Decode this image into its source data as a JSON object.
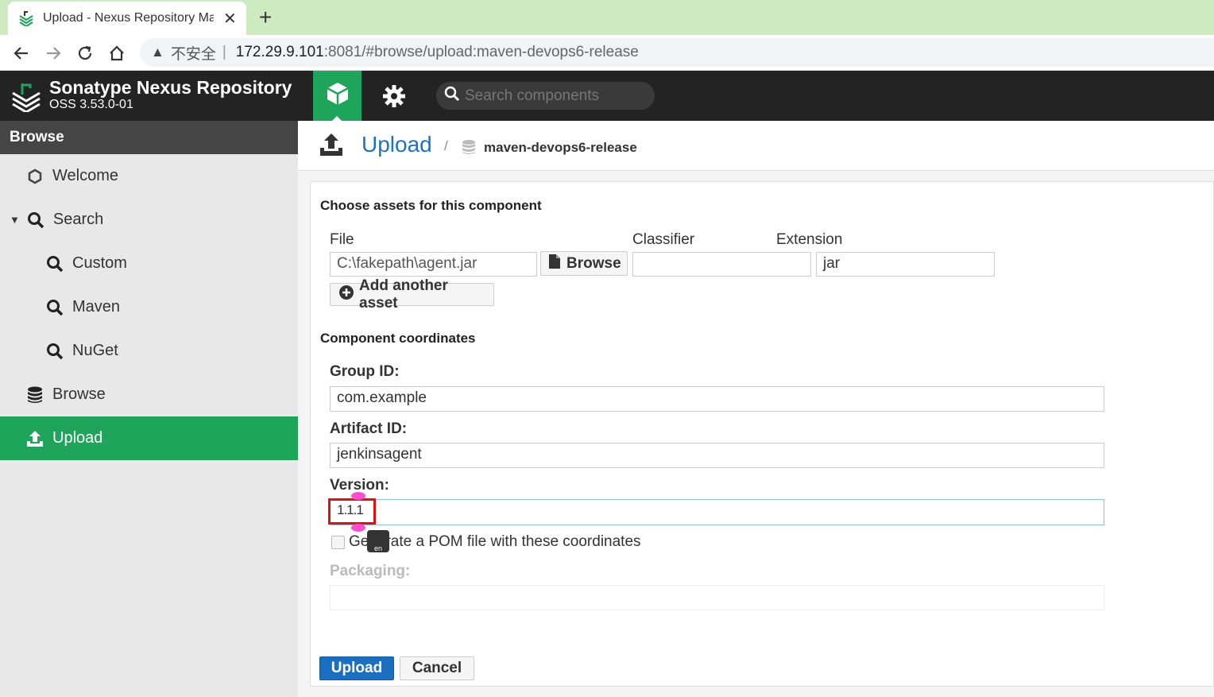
{
  "browser": {
    "tab_title": "Upload - Nexus Repository Manager",
    "security_label": "不安全",
    "url_host": "172.29.9.101",
    "url_rest": ":8081/#browse/upload:maven-devops6-release"
  },
  "header": {
    "title": "Sonatype Nexus Repository",
    "version": "OSS 3.53.0-01",
    "search_placeholder": "Search components"
  },
  "sidebar": {
    "heading": "Browse",
    "items": [
      {
        "label": "Welcome",
        "icon": "hexagon-icon"
      },
      {
        "label": "Search",
        "icon": "search-icon"
      },
      {
        "label": "Custom",
        "icon": "search-icon"
      },
      {
        "label": "Maven",
        "icon": "search-icon"
      },
      {
        "label": "NuGet",
        "icon": "search-icon"
      },
      {
        "label": "Browse",
        "icon": "database-icon"
      },
      {
        "label": "Upload",
        "icon": "upload-icon",
        "active": true
      }
    ]
  },
  "breadcrumb": {
    "title": "Upload",
    "separator": "/",
    "repository": "maven-devops6-release"
  },
  "assets": {
    "section_title": "Choose assets for this component",
    "file_label": "File",
    "classifier_label": "Classifier",
    "extension_label": "Extension",
    "file_value": "C:\\fakepath\\agent.jar",
    "browse_label": "Browse",
    "classifier_value": "",
    "extension_value": "jar",
    "add_asset_label": "Add another asset"
  },
  "coordinates": {
    "section_title": "Component coordinates",
    "group_label": "Group ID:",
    "group_value": "com.example",
    "artifact_label": "Artifact ID:",
    "artifact_value": "jenkinsagent",
    "version_label": "Version:",
    "version_value": "1.1.1",
    "generate_pom_label": "Generate a POM file with these coordinates",
    "generate_pom_checked": false,
    "packaging_label": "Packaging:",
    "packaging_value": ""
  },
  "actions": {
    "upload_label": "Upload",
    "cancel_label": "Cancel"
  },
  "colors": {
    "accent_green": "#1fa45c",
    "primary_blue": "#1a6fc0",
    "highlight_red": "#e01010"
  }
}
